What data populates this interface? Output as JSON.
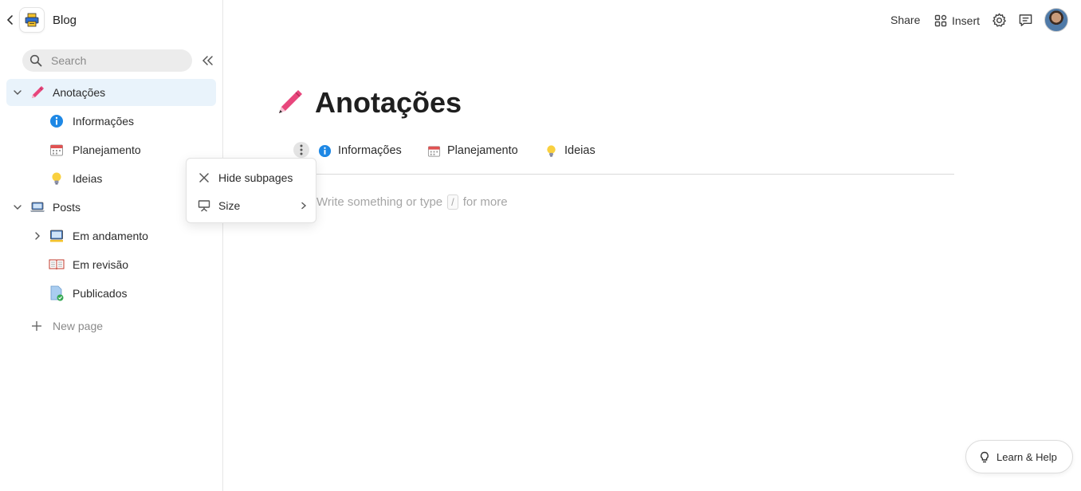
{
  "workspace": {
    "title": "Blog"
  },
  "search": {
    "placeholder": "Search"
  },
  "sidebar": {
    "items": [
      {
        "label": "Anotações",
        "icon": "pen-icon"
      },
      {
        "label": "Informações",
        "icon": "info-icon"
      },
      {
        "label": "Planejamento",
        "icon": "calendar-icon"
      },
      {
        "label": "Ideias",
        "icon": "lightbulb-icon"
      },
      {
        "label": "Posts",
        "icon": "laptop-icon"
      },
      {
        "label": "Em andamento",
        "icon": "monitor-icon"
      },
      {
        "label": "Em revisão",
        "icon": "book-icon"
      },
      {
        "label": "Publicados",
        "icon": "document-check-icon"
      }
    ],
    "new_page_label": "New page"
  },
  "topbar": {
    "share_label": "Share",
    "insert_label": "Insert"
  },
  "page": {
    "title": "Anotações",
    "subpages": [
      {
        "label": "Informações",
        "icon": "info-icon"
      },
      {
        "label": "Planejamento",
        "icon": "calendar-icon"
      },
      {
        "label": "Ideias",
        "icon": "lightbulb-icon"
      }
    ],
    "editor_hint_before": "Write something or type",
    "editor_hint_key": "/",
    "editor_hint_after": "for more"
  },
  "context_menu": {
    "hide_subpages_label": "Hide subpages",
    "size_label": "Size"
  },
  "help": {
    "label": "Learn & Help"
  },
  "colors": {
    "active_bg": "#e9f3fb",
    "info_blue": "#1e88e5",
    "accent_pink": "#e8467c"
  }
}
